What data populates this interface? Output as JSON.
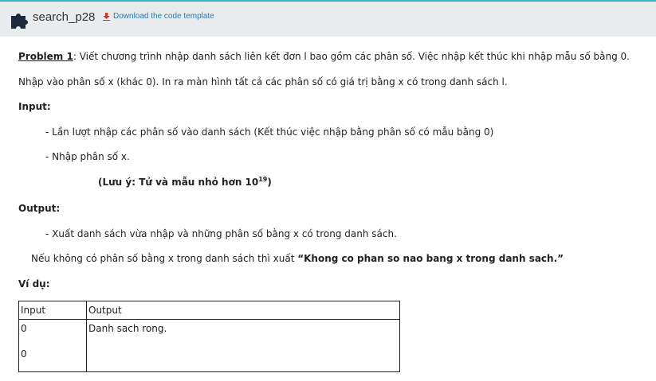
{
  "header": {
    "title": "search_p28",
    "download_label": "Download the code template",
    "accent_color": "#33b5c9",
    "download_color": "#c0392b"
  },
  "problem": {
    "label": "Problem 1",
    "line1": ": Viết chương trình nhập danh sách liên kết đơn l bao gồm các phân số. Việc nhập kết thúc khi nhập mẫu số bằng 0.",
    "line2": "Nhập vào phân số x (khác 0). In ra màn hình tất cả các phân số có giá trị bằng x có trong danh sách l.",
    "input_heading": "Input:",
    "input_item1": "- Lần lượt nhập các phân số vào danh sách  (Kết thúc việc nhập bằng phân số có mẫu bằng 0)",
    "input_item2": "- Nhập phân số x.",
    "note_prefix": "(Lưu ý: Tử và mẫu nhỏ hơn 10",
    "note_exp": "19",
    "note_suffix": ")",
    "output_heading": "Output:",
    "output_item1": "- Xuất danh sách vừa nhập và những phân số bằng x có trong danh sách.",
    "output_note_prefix": "Nếu không có phân số  bằng x trong danh sách thì xuất ",
    "output_note_quote": "“Khong co phan so nao bang x trong danh sach.”",
    "example_heading": "Ví dụ:"
  },
  "example_table": {
    "headers": [
      "Input",
      "Output"
    ],
    "rows": [
      {
        "input_lines": [
          "0",
          "0"
        ],
        "output": "Danh sach rong."
      }
    ]
  }
}
